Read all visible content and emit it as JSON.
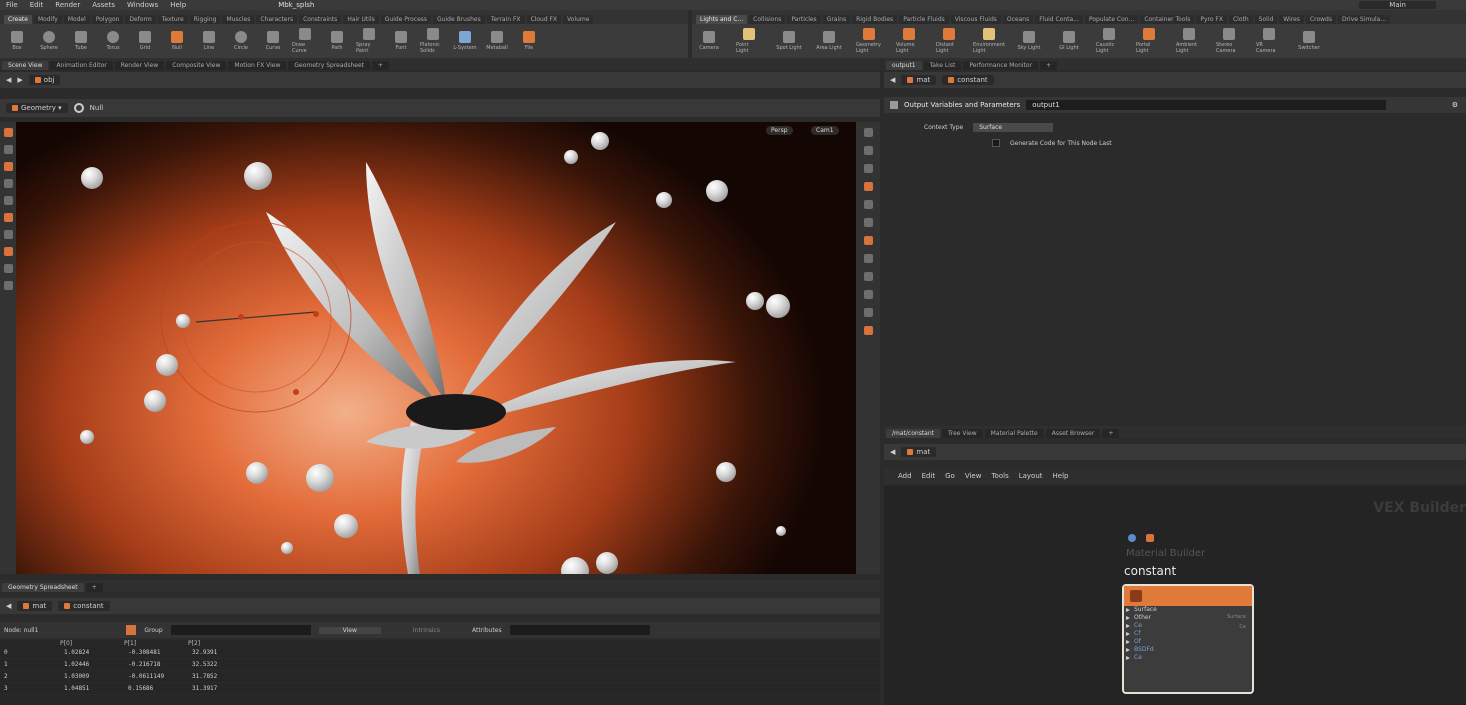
{
  "app": {
    "menu": [
      "File",
      "Edit",
      "Render",
      "Assets",
      "Windows",
      "Help"
    ],
    "scene_file": "Mbk_splsh",
    "desktop": "Main"
  },
  "shelf_left": {
    "tabs": [
      "Create",
      "Modify",
      "Model",
      "Polygon",
      "Deform",
      "Texture",
      "Rigging",
      "Muscles",
      "Characters",
      "Constraints",
      "Hair Utils",
      "Guide Process",
      "Guide Brushes",
      "Terrain FX",
      "Cloud FX",
      "Volume"
    ],
    "tools": [
      {
        "label": "Box",
        "icon": "box-icon"
      },
      {
        "label": "Sphere",
        "icon": "sphere-icon"
      },
      {
        "label": "Tube",
        "icon": "tube-icon"
      },
      {
        "label": "Torus",
        "icon": "torus-icon"
      },
      {
        "label": "Grid",
        "icon": "grid-icon"
      },
      {
        "label": "Null",
        "icon": "null-icon"
      },
      {
        "label": "Line",
        "icon": "line-icon"
      },
      {
        "label": "Circle",
        "icon": "circle-icon"
      },
      {
        "label": "Curve",
        "icon": "curve-icon"
      },
      {
        "label": "Draw Curve",
        "icon": "draw-curve-icon"
      },
      {
        "label": "Path",
        "icon": "path-icon"
      },
      {
        "label": "Spray Paint",
        "icon": "spray-icon"
      },
      {
        "label": "Font",
        "icon": "font-icon"
      },
      {
        "label": "Platonic Solids",
        "icon": "platonic-icon"
      },
      {
        "label": "L-System",
        "icon": "lsystem-icon"
      },
      {
        "label": "Metaball",
        "icon": "metaball-icon"
      },
      {
        "label": "File",
        "icon": "file-icon"
      }
    ]
  },
  "shelf_right": {
    "tabs": [
      "Lights and C...",
      "Collisions",
      "Particles",
      "Grains",
      "Rigid Bodies",
      "Particle Fluids",
      "Viscous Fluids",
      "Oceans",
      "Fluid Conta...",
      "Populate Con...",
      "Container Tools",
      "Pyro FX",
      "Cloth",
      "Solid",
      "Wires",
      "Crowds",
      "Drive Simula..."
    ],
    "tools": [
      {
        "label": "Camera",
        "icon": "camera-icon"
      },
      {
        "label": "Point Light",
        "icon": "point-light-icon"
      },
      {
        "label": "Spot Light",
        "icon": "spot-light-icon"
      },
      {
        "label": "Area Light",
        "icon": "area-light-icon"
      },
      {
        "label": "Geometry Light",
        "icon": "geometry-light-icon"
      },
      {
        "label": "Volume Light",
        "icon": "volume-light-icon"
      },
      {
        "label": "Distant Light",
        "icon": "distant-light-icon"
      },
      {
        "label": "Environment Light",
        "icon": "env-light-icon"
      },
      {
        "label": "Sky Light",
        "icon": "sky-light-icon"
      },
      {
        "label": "GI Light",
        "icon": "gi-light-icon"
      },
      {
        "label": "Caustic Light",
        "icon": "caustic-light-icon"
      },
      {
        "label": "Portal Light",
        "icon": "portal-light-icon"
      },
      {
        "label": "Ambient Light",
        "icon": "ambient-light-icon"
      },
      {
        "label": "Stereo Camera",
        "icon": "stereo-camera-icon"
      },
      {
        "label": "VR Camera",
        "icon": "vr-camera-icon"
      },
      {
        "label": "Switcher",
        "icon": "switcher-icon"
      }
    ]
  },
  "viewer": {
    "tabs": [
      "Scene View",
      "Animation Editor",
      "Render View",
      "Composite View",
      "Motion FX View",
      "Geometry Spreadsheet"
    ],
    "path": "obj",
    "context": "Geometry",
    "node": "Null",
    "hud_persp": "Persp",
    "hud_cam": "Cam1"
  },
  "spreadsheet": {
    "tab": "Geometry Spreadsheet",
    "path": [
      "mat",
      "constant"
    ],
    "node_label": "Node: null1",
    "group_label": "Group",
    "view_label": "View",
    "intrinsics_label": "Intrinsics",
    "attributes_label": "Attributes",
    "columns": [
      "",
      "P[0]",
      "P[1]",
      "P[2]"
    ],
    "rows": [
      [
        "0",
        "1.02824",
        "-0.308481",
        "32.9391"
      ],
      [
        "1",
        "1.02446",
        "-0.216718",
        "32.5322"
      ],
      [
        "2",
        "1.03009",
        "-0.0611149",
        "31.7852"
      ],
      [
        "3",
        "1.04851",
        "0.15686",
        "31.3917"
      ]
    ]
  },
  "params": {
    "tabs": [
      "output1",
      "Take List",
      "Performance Monitor"
    ],
    "path": [
      "mat",
      "constant"
    ],
    "header": "Output Variables and Parameters",
    "node_name": "output1",
    "context_type_label": "Context Type",
    "context_type_value": "Surface",
    "generate_code_label": "Generate Code for This Node Last"
  },
  "network": {
    "tabs": [
      "/mat/constant",
      "Tree View",
      "Material Palette",
      "Asset Browser"
    ],
    "path": "mat",
    "menu": [
      "Add",
      "Edit",
      "Go",
      "View",
      "Tools",
      "Layout",
      "Help"
    ],
    "watermark": "VEX Builder",
    "node_type": "Material Builder",
    "node_name": "constant",
    "ports": [
      "Surface",
      "Other",
      "Ce",
      "Cf",
      "Of",
      "BSDFd",
      "Ce"
    ],
    "port_right": [
      "Surface",
      "Ce"
    ]
  }
}
